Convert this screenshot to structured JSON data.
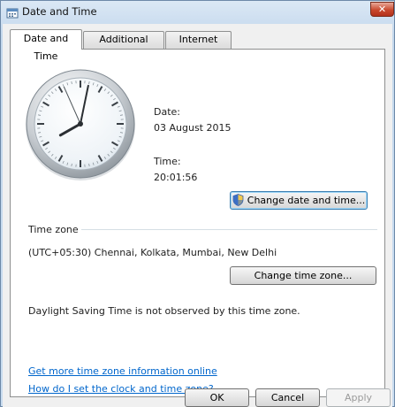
{
  "window": {
    "title": "Date and Time",
    "close_glyph": "✕"
  },
  "tabs": [
    {
      "label": "Date and Time",
      "active": true
    },
    {
      "label": "Additional Clocks",
      "active": false
    },
    {
      "label": "Internet Time",
      "active": false
    }
  ],
  "clock": {
    "hour": 20,
    "minute": 1,
    "second": 56
  },
  "date": {
    "label": "Date:",
    "value": "03 August 2015"
  },
  "time": {
    "label": "Time:",
    "value": "20:01:56"
  },
  "buttons": {
    "change_date_time": "Change date and time...",
    "change_time_zone": "Change time zone...",
    "ok": "OK",
    "cancel": "Cancel",
    "apply": "Apply"
  },
  "timezone": {
    "heading": "Time zone",
    "value": "(UTC+05:30) Chennai, Kolkata, Mumbai, New Delhi",
    "dst_note": "Daylight Saving Time is not observed by this time zone."
  },
  "links": {
    "more_info": "Get more time zone information online",
    "how_to": "How do I set the clock and time zone?"
  },
  "colors": {
    "link": "#0066cc",
    "close": "#c9492e"
  }
}
